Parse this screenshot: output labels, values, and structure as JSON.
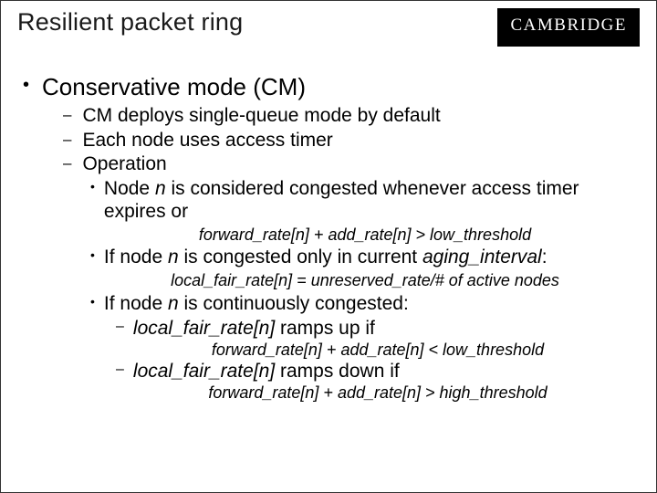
{
  "header": {
    "title": "Resilient packet ring",
    "brand": "CAMBRIDGE"
  },
  "l1": {
    "bullet": "•",
    "text": "Conservative mode (CM)"
  },
  "l2": {
    "bullet": "–",
    "items": [
      "CM deploys single-queue mode by default",
      "Each node uses access timer",
      "Operation"
    ]
  },
  "l3": {
    "bullet": "•",
    "item1_a": "Node ",
    "item1_b": "n",
    "item1_c": " is considered congested whenever access timer expires or",
    "formula1": "forward_rate[n] + add_rate[n] > low_threshold",
    "item2_a": "If node ",
    "item2_b": "n",
    "item2_c": " is congested only in current ",
    "item2_d": "aging_interval",
    "item2_e": ":",
    "formula2": "local_fair_rate[n] = unreserved_rate/# of active nodes",
    "item3_a": "If node ",
    "item3_b": "n",
    "item3_c": " is continuously congested:"
  },
  "l4": {
    "bullet": "–",
    "item1_a": "local_fair_rate[n]",
    "item1_b": " ramps up if",
    "formula1": "forward_rate[n] + add_rate[n] < low_threshold",
    "item2_a": "local_fair_rate[n]",
    "item2_b": " ramps down if",
    "formula2": "forward_rate[n] + add_rate[n] > high_threshold"
  }
}
